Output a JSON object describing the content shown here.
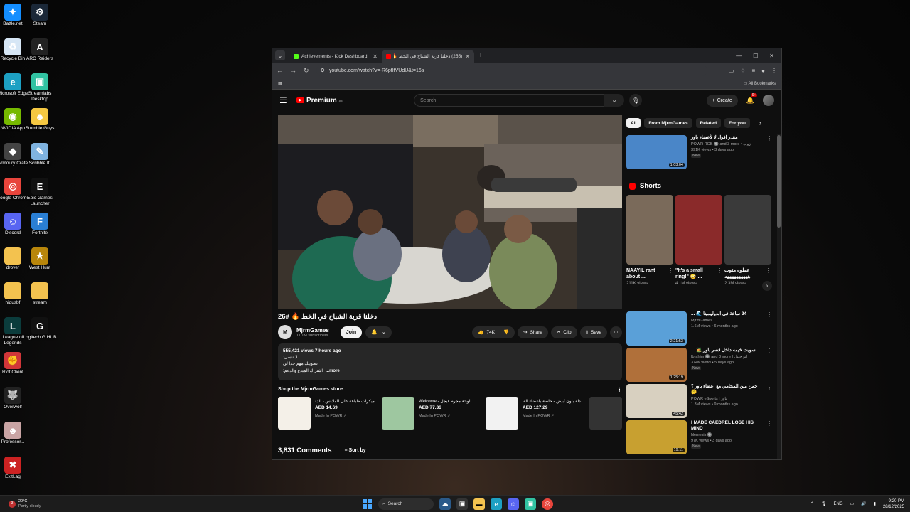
{
  "desktop": {
    "col1": [
      {
        "label": "Battle.net",
        "icon": "battlenet-icon",
        "color": "#148eff",
        "glyph": "✦"
      },
      {
        "label": "Recycle Bin",
        "icon": "recycle-bin-icon",
        "color": "#d6e6f5",
        "glyph": "♻"
      },
      {
        "label": "Microsoft Edge",
        "icon": "edge-icon",
        "color": "#1da0c3",
        "glyph": "e"
      },
      {
        "label": "NVIDIA App",
        "icon": "nvidia-icon",
        "color": "#76b900",
        "glyph": "◉"
      },
      {
        "label": "Armoury Crate",
        "icon": "armoury-crate-icon",
        "color": "#444444",
        "glyph": "◆"
      },
      {
        "label": "Google Chrome",
        "icon": "chrome-icon",
        "color": "#e8453c",
        "glyph": "◎"
      },
      {
        "label": "Discord",
        "icon": "discord-icon",
        "color": "#5865f2",
        "glyph": "☺"
      },
      {
        "label": "drover",
        "icon": "folder-icon",
        "color": "#f3c24f",
        "glyph": ""
      },
      {
        "label": "hidusbf",
        "icon": "folder-icon",
        "color": "#f3c24f",
        "glyph": ""
      },
      {
        "label": "League of Legends",
        "icon": "league-icon",
        "color": "#0b3c3c",
        "glyph": "L"
      },
      {
        "label": "Riot Client",
        "icon": "riot-icon",
        "color": "#d13639",
        "glyph": "✊"
      },
      {
        "label": "Overwolf",
        "icon": "overwolf-icon",
        "color": "#222222",
        "glyph": "🐺"
      },
      {
        "label": "Professor...",
        "icon": "professor-icon",
        "color": "#c9a4a4",
        "glyph": "☻"
      },
      {
        "label": "ExitLag",
        "icon": "exitlag-icon",
        "color": "#cc2222",
        "glyph": "✖"
      }
    ],
    "col2": [
      {
        "label": "Steam",
        "icon": "steam-icon",
        "color": "#1b2838",
        "glyph": "⚙"
      },
      {
        "label": "ARC Raiders",
        "icon": "arc-raiders-icon",
        "color": "#222222",
        "glyph": "A"
      },
      {
        "label": "Streamlabs Desktop",
        "icon": "streamlabs-icon",
        "color": "#31c3a2",
        "glyph": "▣"
      },
      {
        "label": "Stumble Guys",
        "icon": "stumble-guys-icon",
        "color": "#f5c842",
        "glyph": "☻"
      },
      {
        "label": "Scribble It!",
        "icon": "scribble-icon",
        "color": "#7fb3e0",
        "glyph": "✎"
      },
      {
        "label": "Epic Games Launcher",
        "icon": "epic-games-icon",
        "color": "#111111",
        "glyph": "E"
      },
      {
        "label": "Fortnite",
        "icon": "fortnite-icon",
        "color": "#2a7fd4",
        "glyph": "F"
      },
      {
        "label": "West Hunt",
        "icon": "west-hunt-icon",
        "color": "#b8860b",
        "glyph": "★"
      },
      {
        "label": "stream",
        "icon": "folder-icon",
        "color": "#f3c24f",
        "glyph": ""
      },
      {
        "label": "Logitech G HUB",
        "icon": "logitech-icon",
        "color": "#111111",
        "glyph": "G"
      }
    ]
  },
  "browser": {
    "tabs": [
      {
        "title": "Achievements - Kick Dashboard",
        "fav": "#53fc18",
        "active": false
      },
      {
        "title": "(255) دخلنا قرية الشباح في الخط 🔥 #26",
        "fav": "#ff0000",
        "active": true
      }
    ],
    "new_tab": "+",
    "url": "youtube.com/watch?v=-R6pfIfVUdU&t=16s",
    "all_bookmarks": "All Bookmarks"
  },
  "youtube": {
    "logo": "Premium",
    "logo_region": "AE",
    "search_placeholder": "Search",
    "create": "Create",
    "notif_count": "9+",
    "video_title": "دخلنا قرية الشباح في الخط 🔥 #26",
    "channel": {
      "name": "MjrmGames",
      "subs": "11.1M subscribers",
      "join": "Join"
    },
    "actions": {
      "likes": "74K",
      "share": "Share",
      "clip": "Clip",
      "save": "Save"
    },
    "description": {
      "meta": "555,421 views  7 hours ago",
      "lines": [
        "لا تنسى:",
        "تصويتك مهم جدا لي",
        "اشتراك المبدع والدعم:"
      ],
      "more": "...more"
    },
    "store": {
      "heading": "Shop the MjrmGames store",
      "items": [
        {
          "title": "ميكرات طباعة على الملابس - الدانة",
          "price": "AED 14.69",
          "maker": "Made In POWR",
          "color": "#f4f0e8"
        },
        {
          "title": "Welcome - لوحة مجرم فيجل",
          "price": "AED 77.36",
          "maker": "Made In POWR",
          "color": "#9ec7a0"
        },
        {
          "title": "بدلة بلون أبيض - خاصة بأعضاء الفريق",
          "price": "AED 127.29",
          "maker": "Made In POWR",
          "color": "#f2f2f2"
        },
        {
          "title": "",
          "price": "",
          "maker": "",
          "color": "#333333"
        }
      ]
    },
    "comments": {
      "count": "3,831 Comments",
      "sort": "Sort by"
    },
    "chips": [
      "All",
      "From MjrmGames",
      "Related",
      "For you"
    ],
    "shorts_heading": "Shorts",
    "shorts": [
      {
        "title": "NAAYIL rant about ...",
        "views": "211K views",
        "color": "#7a6a5a"
      },
      {
        "title": "\"It's a small ring!\" 😳 ...",
        "views": "4.1M views",
        "color": "#8a2a2a"
      },
      {
        "title": "عطوه متوت ههههههههههه",
        "views": "2.3M views",
        "color": "#3a3a3a"
      }
    ],
    "recs": [
      {
        "title": "مقدر اقول لا لأعضاء باور",
        "channel": "POWR ROB 🔘 and 3 more • زوب",
        "meta": "391K views • 3 days ago",
        "dur": "1:03:04",
        "new": "New",
        "color": "#4a86c8"
      },
      {
        "title": "24 ساعة في الدولوميتا 🌊 ...",
        "channel": "MjrmGames",
        "meta": "1.6M views • 6 months ago",
        "dur": "2:21:53",
        "new": "",
        "color": "#5aa0d8"
      },
      {
        "title": "سويت خيمه داخل قصر باور 🏕️ ...",
        "channel": "Ibrahim 🔘 and 3 more | ابو خليل",
        "meta": "374K views • 5 days ago",
        "dur": "1:25:19",
        "new": "New",
        "color": "#b0703a"
      },
      {
        "title": "خمن مين المحامي مع اعضاء باور ؟ 🤔",
        "channel": "POWR eSports | باور",
        "meta": "1.3M views • 9 months ago",
        "dur": "45:42",
        "new": "",
        "color": "#d8d0c0"
      },
      {
        "title": "I MADE CAEDREL LOSE HIS MIND",
        "channel": "Nemesis 🔘",
        "meta": "97K views • 3 days ago",
        "dur": "19:11",
        "new": "New",
        "color": "#c8a030"
      }
    ]
  },
  "taskbar": {
    "temp": "20°C",
    "weather": "Partly cloudy",
    "badge": "3",
    "search": "Search",
    "lang": "ENG",
    "time": "9:20 PM",
    "date": "28/12/2025"
  }
}
